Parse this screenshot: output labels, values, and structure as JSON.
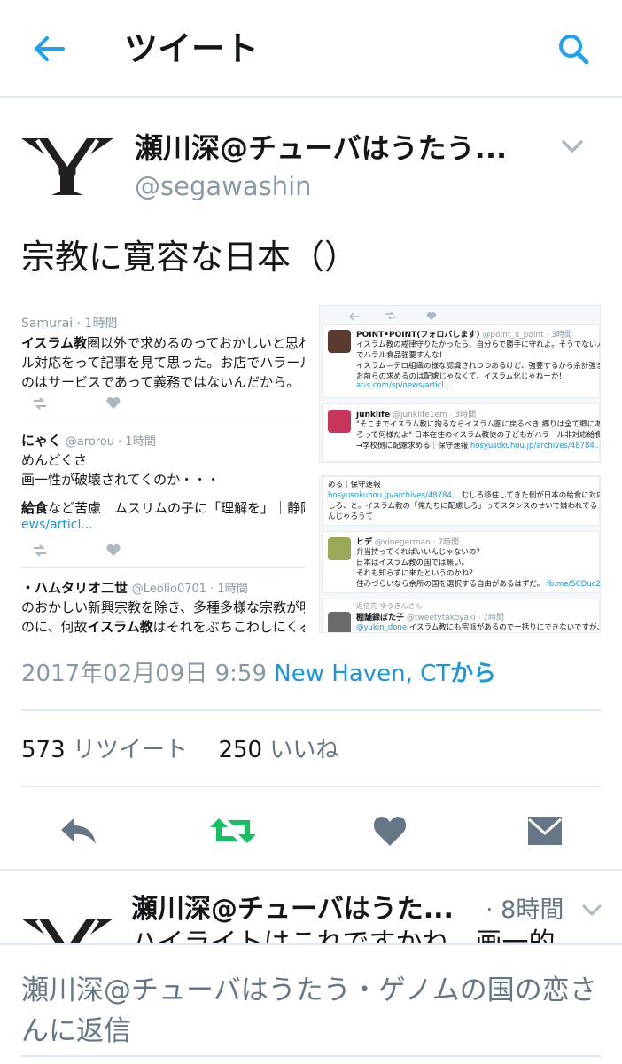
{
  "header": {
    "title": "ツイート",
    "back_icon": "arrow-left-icon",
    "search_icon": "search-icon",
    "accent_color": "#1da1f2"
  },
  "tweet": {
    "author_name": "瀬川深@チューバはうたう・ゲノムの国の恋人",
    "author_name_display": "瀬川深@チューバはうたう...",
    "handle": "@segawashin",
    "text": "宗教に寛容な日本（）",
    "timestamp": {
      "date": "2017年02月09日",
      "time": "9:59",
      "location": "New Haven, CT",
      "suffix": "から"
    },
    "stats": {
      "retweets": "573",
      "retweets_label": "リツイート",
      "likes": "250",
      "likes_label": "いいね"
    },
    "retweet_color": "#17bf63"
  },
  "media": {
    "left": {
      "t1_header": "Samurai · 1時間",
      "t1_l1a": "イスラム教",
      "t1_l1b": "圏以外で求めるのっておかしいと思わ",
      "t1_l2": "ル対応をって記事を見て思った。お店でハラール",
      "t1_l3": "のはサービスであって義務ではないんだから。",
      "t2_name": "にゃく",
      "t2_handle": "@arorou · 1時間",
      "t2_l1": "めんどくさ",
      "t2_l2": "画一性が破壊されてくのか・・・",
      "t2_l3a": "給食",
      "t2_l3b": "など苦慮　ムスリムの子に「理解を」｜静岡",
      "t2_l4": "ews/articl...",
      "t3_name": "・ハムタリオ二世",
      "t3_handle": "@Leolio0701 · 1時間",
      "t3_l1": "のおかしい新興宗教を除き、多種多様な宗教が明",
      "t3_l2a": "のに、何故",
      "t3_l2b": "イスラム教",
      "t3_l2c": "はそれをぶちこわしにくる"
    },
    "right_top": {
      "c1_name": "POINT•POINT(フォロバします)",
      "c1_handle": "@point_x_point · 3時間",
      "c1_l1": "イスラム教の戒律守りたかったら、自分らで勝手に守れよ。そうでない人間にま",
      "c1_l2": "でハラル食品強要すんな！",
      "c1_l3": "イスラム＝テロ組織の様な認識されつつあるけど、強要するから余計強まった！",
      "c1_l4": "お前らの求めるのは配慮じゃなくて、イスラム化じゃねーか！",
      "c1_l5": "at-s.com/sp/news/articl...",
      "c2_name": "junklife",
      "c2_handle": "@junklife1em · 3時間",
      "c2_l1": "\"そこまでイスラム教に拘るならイスラム圏に戻るべき 郷りは全て郷にあわせ",
      "c2_l2": "ろって何様だよ\" 日本在住のイスラム教徒の子どもがハラール非対応給食に苦慮",
      "c2_l3": "→学校側に配慮求める｜保守速報",
      "c2_l3_link": "hosyusokuhou.jp/archives/48784..."
    },
    "right_bottom": {
      "r1_l1": "める｜保守速報",
      "r1_l2a": "hosyusokuhou.jp/archives/48784...",
      "r1_l2b": "むしろ移住してきた側が日本の給食に対応",
      "r1_l3": "しろ、と。イスラム教の「俺たちに配慮しろ」ってスタンスのせいで嫌われてる",
      "r1_l4": "んじゃろうて",
      "r2_name": "ヒデ",
      "r2_handle": "@vinegerman · 7時間",
      "r2_l1": "弁当持ってくればいいんじゃないの？",
      "r2_l2": "日本はイスラム教の国では無い。",
      "r2_l3": "それも知らずに来たというのかね？",
      "r2_l4a": "住みづらいなら余所の国を選択する自由があるはずだ。",
      "r2_l4b": "fb.me/5CDuc2esK",
      "r3_reply": "返信先 ゆうきんさん",
      "r3_name": "棚舗録ぼた子",
      "r3_handle": "@tweetytakoyaki · 7時間",
      "r3_l1a": "@yukin_done",
      "r3_l1b": "イスラム教にも宗派があるので一括りにできないですが、私は公"
    }
  },
  "actions": {
    "reply_icon": "reply-icon",
    "retweet_icon": "retweet-icon",
    "like_icon": "heart-icon",
    "dm_icon": "envelope-icon"
  },
  "reply_tweet": {
    "author_name": "瀬川深@チューバはうた...",
    "time": "· 8時間",
    "text": "ハイライトはこれですかね、画一的"
  },
  "reply_bar": {
    "placeholder": "瀬川深@チューバはうたう・ゲノムの国の恋さんに返信"
  }
}
